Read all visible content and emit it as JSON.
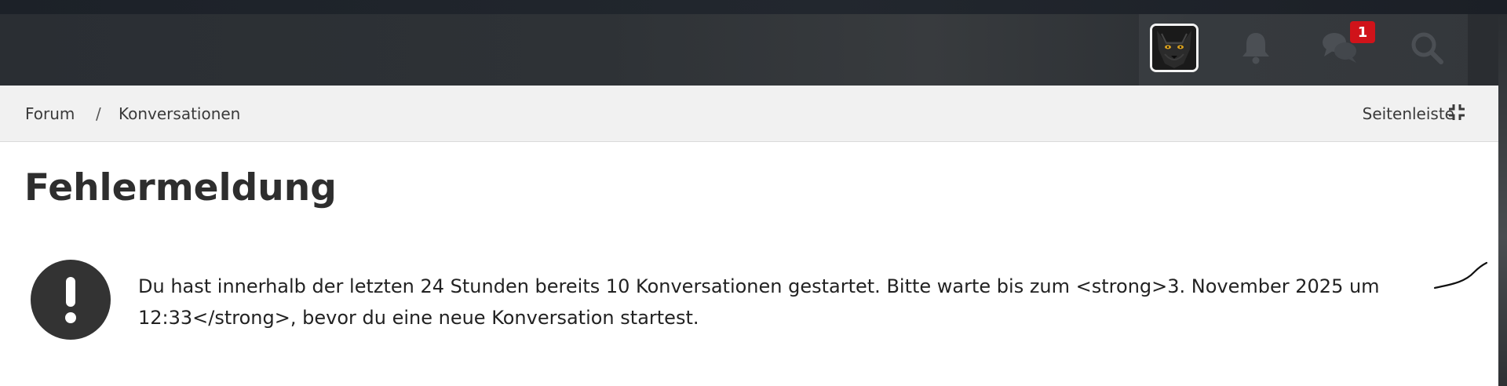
{
  "header": {
    "notifications_badge": "1",
    "icons": [
      "avatar",
      "bell-icon",
      "conversations-icon",
      "search-icon"
    ]
  },
  "breadcrumb": {
    "items": [
      "Forum",
      "Konversationen"
    ],
    "separator": "/",
    "sidebar_label": "Seitenleiste"
  },
  "page": {
    "title": "Fehlermeldung"
  },
  "error": {
    "line1": "Du hast innerhalb der letzten 24 Stunden bereits 10 Konversationen gestartet. Bitte warte bis zum <strong>3. November 2025 um",
    "line2": "12:33</strong>, bevor du eine neue Konversation startest."
  },
  "colors": {
    "header_bg": "#2e3236",
    "badge": "#d0131a",
    "crumbbar_bg": "#f1f1f1",
    "alert_icon_bg": "#333333",
    "text": "#222222"
  }
}
